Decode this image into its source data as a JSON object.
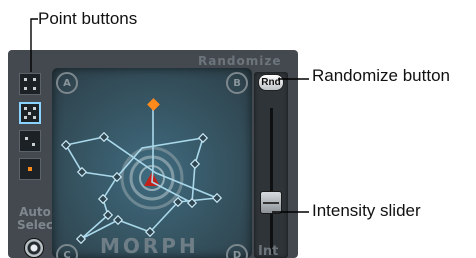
{
  "callouts": {
    "point_buttons": "Point buttons",
    "randomize_button": "Randomize button",
    "intensity_slider": "Intensity slider"
  },
  "panel": {
    "randomize_title": "Randomize",
    "morph_label": "MORPH",
    "int_label": "Int",
    "corners": [
      "A",
      "B",
      "C",
      "D"
    ],
    "rnd_button_label": "Rnd",
    "auto_select_line1": "Auto",
    "auto_select_line2": "Select"
  },
  "point_buttons": [
    {
      "pattern": "corners",
      "selected": false
    },
    {
      "pattern": "corners-center",
      "selected": true
    },
    {
      "pattern": "small",
      "selected": false
    },
    {
      "pattern": "orange-center",
      "selected": false
    }
  ],
  "intensity_level": 0.35,
  "colors": {
    "panel_bg": "#43494e",
    "pad_bg": "#35525f",
    "path_line": "#a9d8ea",
    "selected_border": "#8ad3ff",
    "orange_point": "#ff8a1c",
    "center_red": "#c4201a"
  },
  "icons": {
    "morph_center": "target-rings-icon",
    "auto_select": "radio-button-icon"
  }
}
